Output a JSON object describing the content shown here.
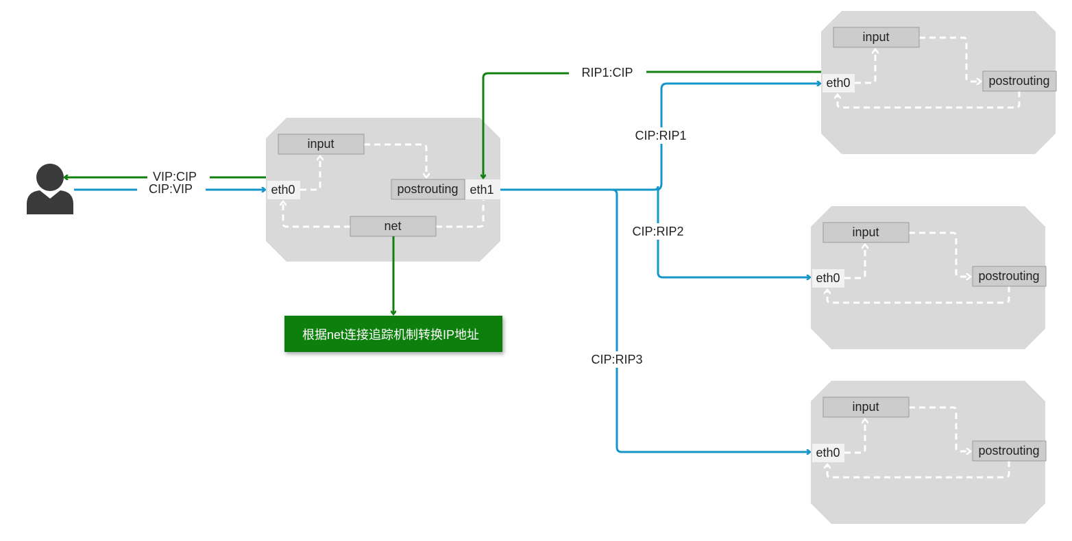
{
  "colors": {
    "request": "#1596c8",
    "response": "#118011",
    "node": "#d9d9d9",
    "note": "#0a7f0a"
  },
  "client": {
    "icon": "user-icon",
    "to_client_label": "VIP:CIP",
    "from_client_label": "CIP:VIP"
  },
  "director": {
    "input": "input",
    "postrouting": "postrouting",
    "net": "net",
    "eth0": "eth0",
    "eth1": "eth1"
  },
  "note": "根据net连接追踪机制转换IP地址",
  "links": {
    "rip1_cip": "RIP1:CIP",
    "cip_rip1": "CIP:RIP1",
    "cip_rip2": "CIP:RIP2",
    "cip_rip3": "CIP:RIP3"
  },
  "real_servers": [
    {
      "input": "input",
      "postrouting": "postrouting",
      "eth0": "eth0"
    },
    {
      "input": "input",
      "postrouting": "postrouting",
      "eth0": "eth0"
    },
    {
      "input": "input",
      "postrouting": "postrouting",
      "eth0": "eth0"
    }
  ]
}
